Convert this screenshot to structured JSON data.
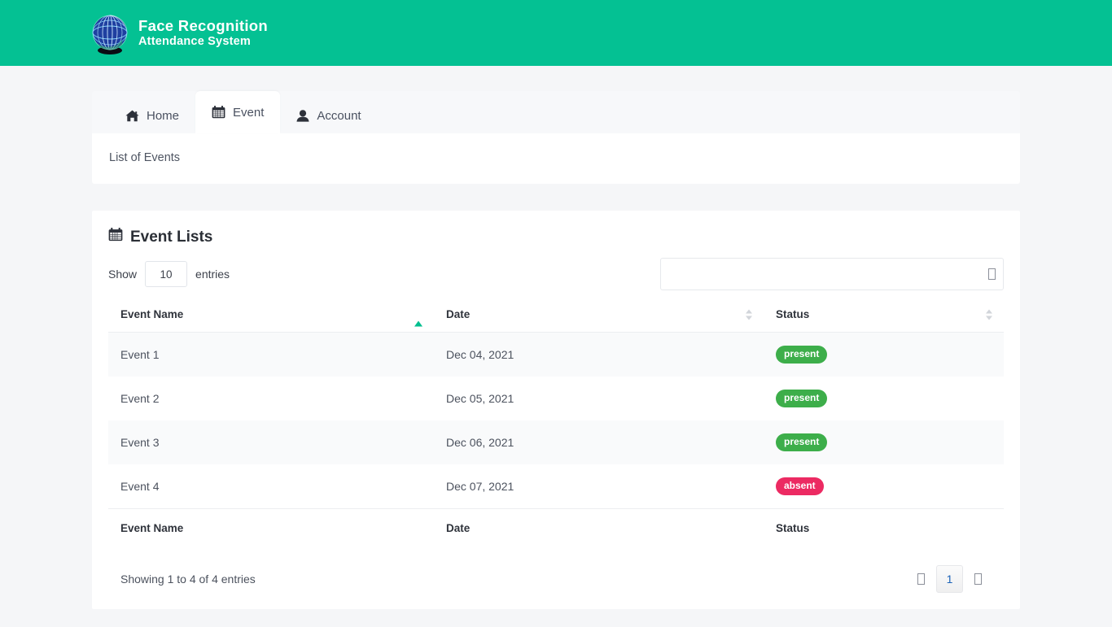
{
  "brand": {
    "logo_icon": "globe-icon",
    "line1": "Face Recognition",
    "line2": "Attendance System",
    "header_color": "#04c193"
  },
  "tabs": [
    {
      "id": "home",
      "label": "Home",
      "icon": "home-icon",
      "active": false
    },
    {
      "id": "event",
      "label": "Event",
      "icon": "calendar-icon",
      "active": true
    },
    {
      "id": "account",
      "label": "Account",
      "icon": "user-icon",
      "active": false
    }
  ],
  "subpanel": {
    "text": "List of Events"
  },
  "card": {
    "icon": "calendar-icon",
    "title": "Event Lists"
  },
  "controls": {
    "show_label": "Show",
    "entries_label": "entries",
    "page_length": "10",
    "search_value": "",
    "search_placeholder": "",
    "search_icon": "missing-glyph-box"
  },
  "table": {
    "columns": [
      {
        "label": "Event Name",
        "sort": "asc"
      },
      {
        "label": "Date",
        "sort": "none"
      },
      {
        "label": "Status",
        "sort": "none"
      }
    ],
    "rows": [
      {
        "name": "Event 1",
        "date": "Dec 04, 2021",
        "status": "present"
      },
      {
        "name": "Event 2",
        "date": "Dec 05, 2021",
        "status": "present"
      },
      {
        "name": "Event 3",
        "date": "Dec 06, 2021",
        "status": "present"
      },
      {
        "name": "Event 4",
        "date": "Dec 07, 2021",
        "status": "absent"
      }
    ],
    "footer_columns": [
      "Event Name",
      "Date",
      "Status"
    ],
    "status_colors": {
      "present": "#3dae4a",
      "absent": "#ec2a62"
    }
  },
  "footer": {
    "info": "Showing 1 to 4 of 4 entries",
    "pagination": {
      "previous_label": "□",
      "next_label": "□",
      "pages": [
        "1"
      ],
      "current": "1"
    }
  }
}
